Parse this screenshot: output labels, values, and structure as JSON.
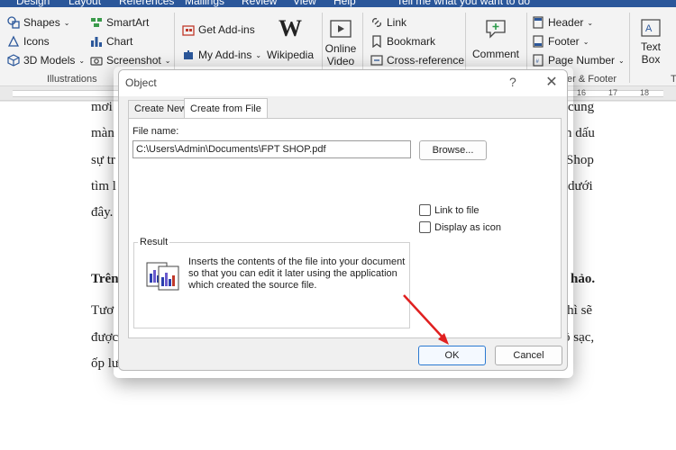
{
  "ribbon": {
    "tabs": [
      "Design",
      "Layout",
      "References",
      "Mailings",
      "Review",
      "View",
      "Help",
      "Tell me what you want to do"
    ],
    "illustrations": {
      "shapes": "Shapes",
      "icons": "Icons",
      "models_3d": "3D Models",
      "smartart": "SmartArt",
      "chart": "Chart",
      "screenshot": "Screenshot",
      "group_label": "Illustrations"
    },
    "addins": {
      "get": "Get Add-ins",
      "my": "My Add-ins",
      "wikipedia": "Wikipedia"
    },
    "media": {
      "online_video_1": "Online",
      "online_video_2": "Video"
    },
    "links": {
      "link": "Link",
      "bookmark": "Bookmark",
      "cross_reference": "Cross-reference"
    },
    "comments": {
      "comment": "Comment"
    },
    "header_footer": {
      "header": "Header",
      "footer": "Footer",
      "page_number": "Page Number",
      "group_label": "er & Footer"
    },
    "text": {
      "text_box_1": "Text",
      "text_box_2": "Box"
    },
    "trailing_label": "T"
  },
  "ruler": {
    "numbers": [
      "16",
      "17",
      "18"
    ]
  },
  "document": {
    "lines_left": [
      "mơi",
      "màn",
      "sự tr",
      "tìm l",
      "đây."
    ],
    "lines_right": [
      "cung",
      "n dấu",
      "Shop",
      "dưới"
    ],
    "bold_left": "Trên",
    "bold_right": "hảo.",
    "lines2_left": [
      "Tươ",
      "được",
      "ốp lư"
    ],
    "lines2_right": [
      "thì sẽ",
      "ồ sạc,"
    ]
  },
  "dialog": {
    "title": "Object",
    "help": "?",
    "close": "✕",
    "tabs": {
      "create_new": "Create New",
      "create_from_file": "Create from File"
    },
    "file_name_label": "File name:",
    "file_name_value": "C:\\Users\\Admin\\Documents\\FPT SHOP.pdf",
    "browse": "Browse...",
    "link_to_file": "Link to file",
    "display_as_icon": "Display as icon",
    "result_label": "Result",
    "result_text": "Inserts the contents of the file into your document so that you can edit it later using the application which created the source file.",
    "ok": "OK",
    "cancel": "Cancel"
  },
  "colors": {
    "accent": "#2b579a",
    "arrow": "#e02020",
    "ok_border": "#2b79d1"
  }
}
